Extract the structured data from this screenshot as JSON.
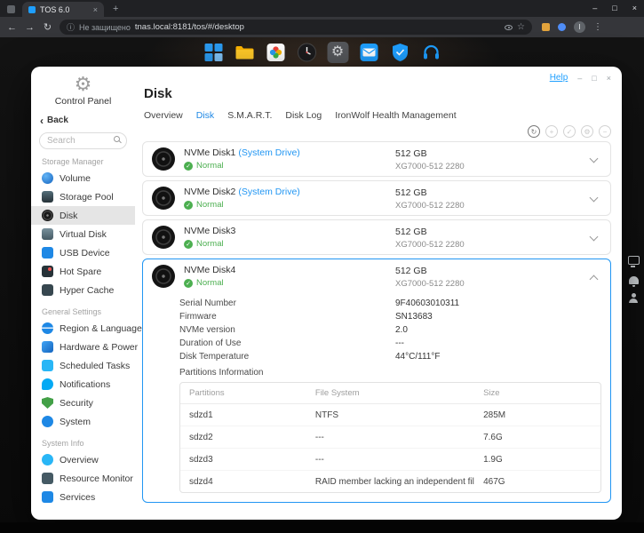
{
  "browser": {
    "tab_title": "TOS 6.0",
    "security_label": "Не защищено",
    "url": "tnas.local:8181/tos/#/desktop",
    "profile_initial": "I"
  },
  "icons": {
    "back_arrow": "←",
    "forward_arrow": "→",
    "reload": "↻",
    "star": "☆",
    "menu": "⋮",
    "minimize": "–",
    "maximize": "□",
    "close": "×",
    "tab_close": "×",
    "new_tab": "+",
    "gear": "⚙",
    "check": "✓",
    "info": "ⓘ",
    "back_chevron": "‹",
    "toolbar": [
      {
        "name": "refresh-circle",
        "glyph": "↻"
      },
      {
        "name": "add-circle",
        "glyph": "+"
      },
      {
        "name": "ok-circle",
        "glyph": "✓"
      },
      {
        "name": "settings-circle",
        "glyph": "⚙"
      },
      {
        "name": "remove-circle",
        "glyph": "−"
      }
    ],
    "dock": [
      "app-launcher",
      "file-manager",
      "photos",
      "clock",
      "control-panel",
      "mail",
      "security",
      "support"
    ]
  },
  "window": {
    "help": "Help",
    "brand": "Control Panel",
    "back": "Back",
    "search_placeholder": "Search"
  },
  "sidebar": {
    "sections": [
      {
        "title": "Storage Manager",
        "items": [
          {
            "label": "Volume"
          },
          {
            "label": "Storage Pool"
          },
          {
            "label": "Disk"
          },
          {
            "label": "Virtual Disk"
          },
          {
            "label": "USB Device"
          },
          {
            "label": "Hot Spare"
          },
          {
            "label": "Hyper Cache"
          }
        ]
      },
      {
        "title": "General Settings",
        "items": [
          {
            "label": "Region & Language"
          },
          {
            "label": "Hardware & Power"
          },
          {
            "label": "Scheduled Tasks"
          },
          {
            "label": "Notifications"
          },
          {
            "label": "Security"
          },
          {
            "label": "System"
          }
        ]
      },
      {
        "title": "System Info",
        "items": [
          {
            "label": "Overview"
          },
          {
            "label": "Resource Monitor"
          },
          {
            "label": "Services"
          }
        ]
      }
    ]
  },
  "page": {
    "title": "Disk",
    "tabs": [
      {
        "label": "Overview"
      },
      {
        "label": "Disk"
      },
      {
        "label": "S.M.A.R.T."
      },
      {
        "label": "Disk Log"
      },
      {
        "label": "IronWolf Health Management"
      }
    ]
  },
  "disks": [
    {
      "name": "NVMe Disk1",
      "tag": "(System Drive)",
      "status": "Normal",
      "size": "512 GB",
      "model": "XG7000-512 2280"
    },
    {
      "name": "NVMe Disk2",
      "tag": "(System Drive)",
      "status": "Normal",
      "size": "512 GB",
      "model": "XG7000-512 2280"
    },
    {
      "name": "NVMe Disk3",
      "tag": "",
      "status": "Normal",
      "size": "512 GB",
      "model": "XG7000-512 2280"
    },
    {
      "name": "NVMe Disk4",
      "tag": "",
      "status": "Normal",
      "size": "512 GB",
      "model": "XG7000-512 2280"
    }
  ],
  "details": {
    "fields": [
      {
        "label": "Serial Number",
        "value": "9F40603010311"
      },
      {
        "label": "Firmware",
        "value": "SN13683"
      },
      {
        "label": "NVMe version",
        "value": "2.0"
      },
      {
        "label": "Duration of Use",
        "value": "---"
      },
      {
        "label": "Disk Temperature",
        "value": "44°C/111°F"
      }
    ],
    "partitions_title": "Partitions Information",
    "table": {
      "headers": [
        {
          "label": "Partitions"
        },
        {
          "label": "File System"
        },
        {
          "label": "Size"
        }
      ],
      "rows": [
        {
          "partition": "sdzd1",
          "fs": "NTFS",
          "size": "285M"
        },
        {
          "partition": "sdzd2",
          "fs": "---",
          "size": "7.6G"
        },
        {
          "partition": "sdzd3",
          "fs": "---",
          "size": "1.9G"
        },
        {
          "partition": "sdzd4",
          "fs": "RAID member lacking an independent file system",
          "size": "467G"
        }
      ]
    }
  }
}
